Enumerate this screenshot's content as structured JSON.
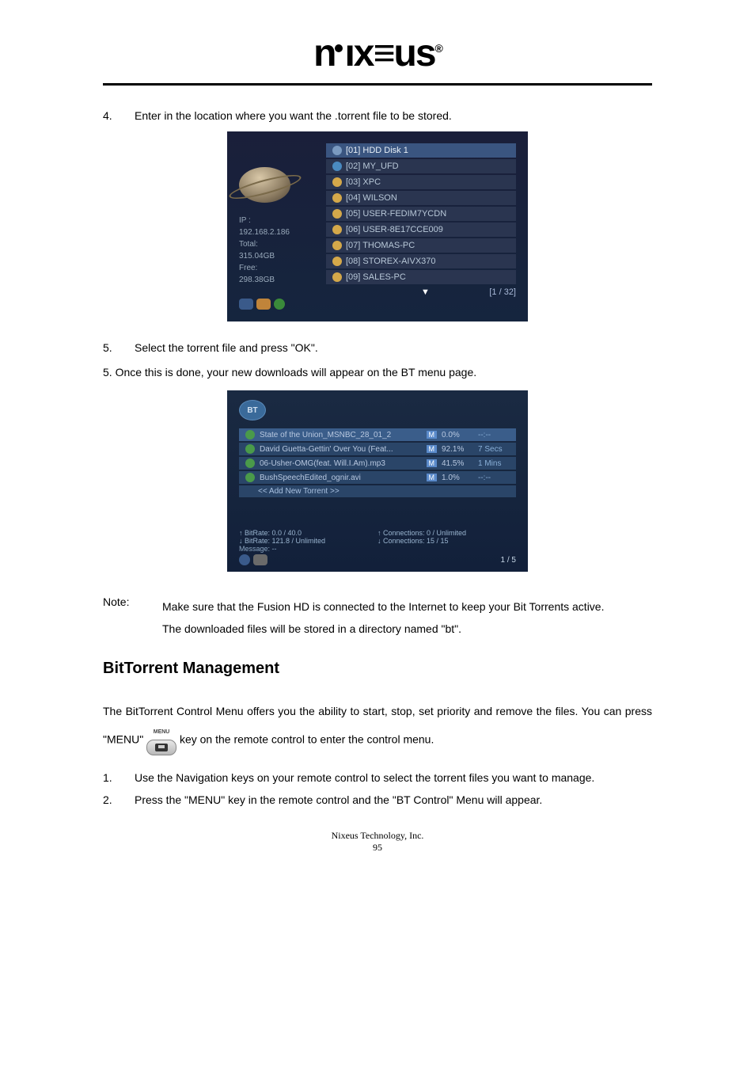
{
  "logo": {
    "text": "nıx≡us",
    "reg": "®"
  },
  "step4": {
    "num": "4.",
    "text": "Enter in the location where you want the .torrent file to be stored."
  },
  "ss1": {
    "ip_label": "IP :",
    "ip": "192.168.2.186",
    "total_label": "Total:",
    "total": "315.04GB",
    "free_label": "Free:",
    "free": "298.38GB",
    "items": [
      "[01] HDD Disk 1",
      "[02] MY_UFD",
      "[03] XPC",
      "[04] WILSON",
      "[05] USER-FEDIM7YCDN",
      "[06] USER-8E17CCE009",
      "[07] THOMAS-PC",
      "[08] STOREX-AIVX370",
      "[09] SALES-PC"
    ],
    "arrow": "▼",
    "page": "[1 / 32]"
  },
  "step5": {
    "num": "5.",
    "text": "Select the torrent file and press \"OK\"."
  },
  "step5b": {
    "text": "5. Once this is done, your new downloads will appear on the BT menu page."
  },
  "ss2": {
    "logo": "BT",
    "rows": [
      {
        "name": "State of the Union_MSNBC_28_01_2",
        "m": "M",
        "pct": "0.0%",
        "time": "--:--"
      },
      {
        "name": "David Guetta-Gettin' Over You (Feat...",
        "m": "M",
        "pct": "92.1%",
        "time": "7 Secs"
      },
      {
        "name": "06-Usher-OMG(feat. Will.I.Am).mp3",
        "m": "M",
        "pct": "41.5%",
        "time": "1 Mins"
      },
      {
        "name": "BushSpeechEdited_ognir.avi",
        "m": "M",
        "pct": "1.0%",
        "time": "--:--"
      }
    ],
    "add": "<< Add New Torrent >>",
    "up_bitrate": "↑ BitRate:   0.0 /  40.0",
    "dn_bitrate": "↓ BitRate: 121.8 / Unlimited",
    "up_conn": "↑ Connections: 0 / Unlimited",
    "dn_conn": "↓ Connections: 15 / 15",
    "message": "Message: --",
    "page": "1 / 5"
  },
  "note": {
    "label": "Note:",
    "line1": "Make sure that the Fusion HD is connected to the Internet to keep your Bit Torrents active.",
    "line2": "The downloaded files will be stored in a directory named \"bt\"."
  },
  "section_title": "BitTorrent Management",
  "para1": "The BitTorrent Control Menu offers you the ability to start, stop, set priority and remove the files. You can press \"MENU\" ",
  "menu_key_label": "MENU",
  "para1b": " key on the remote control to enter the control menu.",
  "mgmt_steps": [
    {
      "num": "1.",
      "text": "Use the Navigation keys on your remote control to select the torrent files you want to manage."
    },
    {
      "num": "2.",
      "text": "Press the \"MENU\" key in the remote control and the \"BT Control\" Menu will appear."
    }
  ],
  "footer": {
    "company": "Nixeus Technology, Inc.",
    "page": "95"
  }
}
